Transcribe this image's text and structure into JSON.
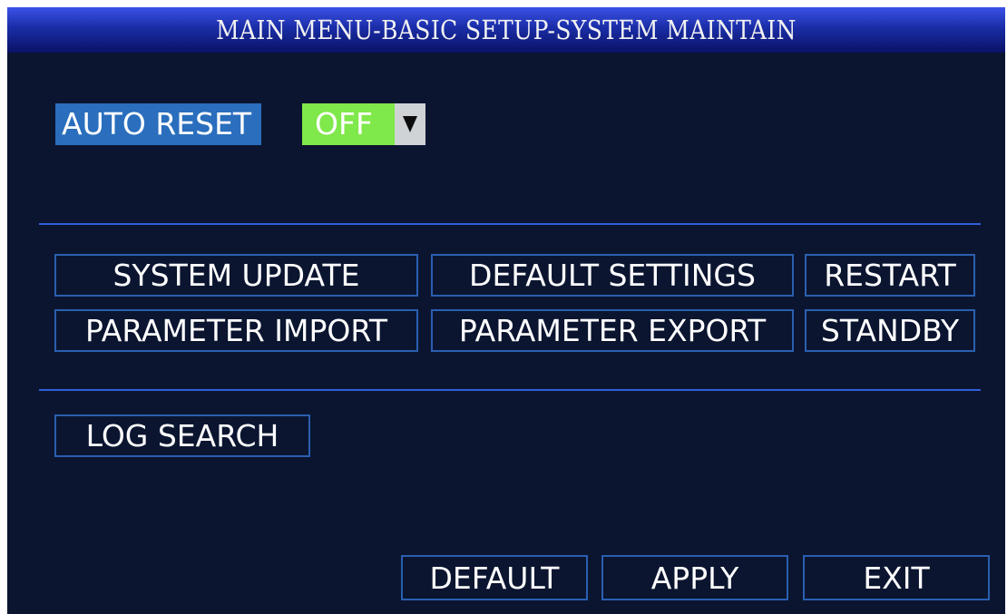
{
  "window": {
    "title": "MAIN MENU-BASIC SETUP-SYSTEM MAINTAIN"
  },
  "auto_reset": {
    "label": "AUTO RESET",
    "value": "OFF",
    "arrow_icon": "triangle-down-icon"
  },
  "actions": {
    "system_update": "SYSTEM UPDATE",
    "default_settings": "DEFAULT SETTINGS",
    "restart": "RESTART",
    "parameter_import": "PARAMETER IMPORT",
    "parameter_export": "PARAMETER EXPORT",
    "standby": "STANDBY",
    "log_search": "LOG SEARCH"
  },
  "footer": {
    "default": "DEFAULT",
    "apply": "APPLY",
    "exit": "EXIT"
  },
  "colors": {
    "background": "#0b1530",
    "title_gradient_top": "#3b52e8",
    "title_gradient_bottom": "#0a1266",
    "label_highlight": "#2a6ebd",
    "dropdown_value": "#7fe84a",
    "button_border": "#2a5fb0",
    "divider": "#2f5ed8"
  }
}
